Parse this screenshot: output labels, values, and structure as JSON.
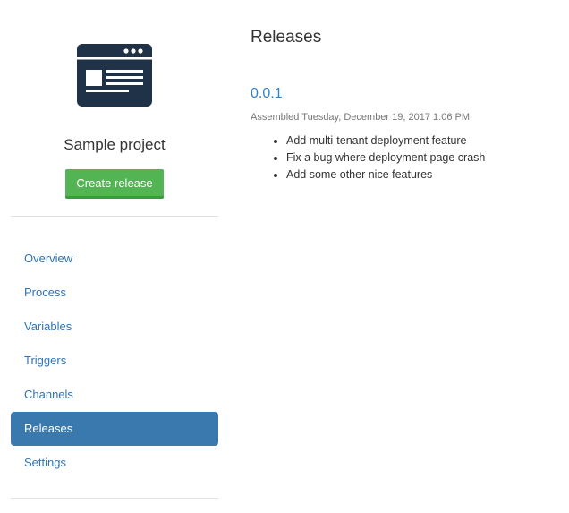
{
  "sidebar": {
    "project_name": "Sample project",
    "create_release_label": "Create release",
    "nav_items": [
      {
        "label": "Overview",
        "active": false
      },
      {
        "label": "Process",
        "active": false
      },
      {
        "label": "Variables",
        "active": false
      },
      {
        "label": "Triggers",
        "active": false
      },
      {
        "label": "Channels",
        "active": false
      },
      {
        "label": "Releases",
        "active": true
      },
      {
        "label": "Settings",
        "active": false
      }
    ]
  },
  "main": {
    "title": "Releases",
    "release": {
      "version": "0.0.1",
      "assembled_text": "Assembled Tuesday, December 19, 2017 1:06 PM",
      "notes": [
        "Add multi-tenant deployment feature",
        "Fix a bug where deployment page crash",
        "Add some other nice features"
      ]
    }
  },
  "colors": {
    "logo": "#1f3248",
    "create_button": "#52b452",
    "nav_link": "#2f74b5",
    "nav_active_bg": "#3a79ad",
    "version_link": "#2f84c8"
  },
  "icons": {
    "project_logo": "browser-window-icon"
  }
}
